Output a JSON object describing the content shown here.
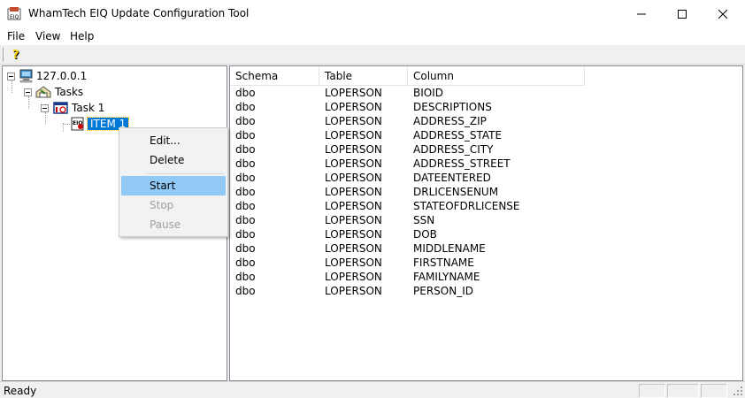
{
  "window": {
    "title": "WhamTech EIQ Update Configuration Tool",
    "icon": "app-icon"
  },
  "menu": [
    "File",
    "View",
    "Help"
  ],
  "toolbar": {
    "help_icon": "help-icon"
  },
  "tree": {
    "root": "127.0.0.1",
    "tasks": "Tasks",
    "task": "Task 1",
    "item": "ITEM 1"
  },
  "list": {
    "columns": [
      "Schema",
      "Table",
      "Column"
    ],
    "rows": [
      [
        "dbo",
        "LOPERSON",
        "BIOID"
      ],
      [
        "dbo",
        "LOPERSON",
        "DESCRIPTIONS"
      ],
      [
        "dbo",
        "LOPERSON",
        "ADDRESS_ZIP"
      ],
      [
        "dbo",
        "LOPERSON",
        "ADDRESS_STATE"
      ],
      [
        "dbo",
        "LOPERSON",
        "ADDRESS_CITY"
      ],
      [
        "dbo",
        "LOPERSON",
        "ADDRESS_STREET"
      ],
      [
        "dbo",
        "LOPERSON",
        "DATEENTERED"
      ],
      [
        "dbo",
        "LOPERSON",
        "DRLICENSENUM"
      ],
      [
        "dbo",
        "LOPERSON",
        "STATEOFDRLICENSE"
      ],
      [
        "dbo",
        "LOPERSON",
        "SSN"
      ],
      [
        "dbo",
        "LOPERSON",
        "DOB"
      ],
      [
        "dbo",
        "LOPERSON",
        "MIDDLENAME"
      ],
      [
        "dbo",
        "LOPERSON",
        "FIRSTNAME"
      ],
      [
        "dbo",
        "LOPERSON",
        "FAMILYNAME"
      ],
      [
        "dbo",
        "LOPERSON",
        "PERSON_ID"
      ]
    ]
  },
  "context_menu": {
    "items": [
      {
        "label": "Edit...",
        "enabled": true,
        "highlighted": false
      },
      {
        "label": "Delete",
        "enabled": true,
        "highlighted": false
      },
      {
        "label": "Start",
        "enabled": true,
        "highlighted": true
      },
      {
        "label": "Stop",
        "enabled": false,
        "highlighted": false
      },
      {
        "label": "Pause",
        "enabled": false,
        "highlighted": false
      }
    ]
  },
  "status": {
    "text": "Ready"
  },
  "colors": {
    "selection": "#0078d7",
    "menu_highlight": "#91c9f7",
    "disabled_text": "#a0a0a0"
  }
}
